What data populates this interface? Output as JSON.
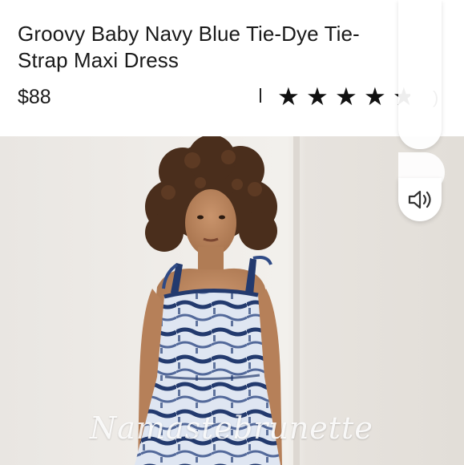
{
  "product": {
    "title": "Groovy Baby Navy Blue Tie-Dye Tie-Strap Maxi Dress",
    "price": "$88",
    "rating": 4.5,
    "rating_count": ")"
  },
  "watermark": "Namastebrunette",
  "icons": {
    "star": "★",
    "volume": "speaker-volume-icon"
  },
  "colors": {
    "text": "#1a1a1a",
    "dress_navy": "#233a6e",
    "dress_white": "#dfe6f2",
    "hair": "#4a2e1c"
  }
}
